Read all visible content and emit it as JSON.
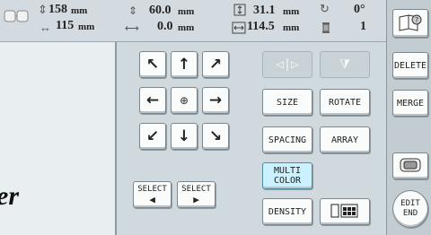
{
  "top": {
    "height_value": "158",
    "height_unit": "mm",
    "width_value": "115",
    "width_unit": "mm",
    "move_v_value": "60.0",
    "move_v_unit": "mm",
    "move_h_value": "0.0",
    "move_h_unit": "mm",
    "size_h_value": "31.1",
    "size_h_unit": "mm",
    "size_w_value": "114.5",
    "size_w_unit": "mm",
    "angle_value": "0°",
    "colors_value": "1"
  },
  "buttons": {
    "size": "SIZE",
    "rotate": "ROTATE",
    "spacing": "SPACING",
    "array": "ARRAY",
    "multi_color_line1": "MULTI",
    "multi_color_line2": "COLOR",
    "density": "DENSITY",
    "select_prev": "SELECT",
    "select_next": "SELECT"
  },
  "sidebar": {
    "delete": "DELETE",
    "merge": "MERGE",
    "edit_end_line1": "EDIT",
    "edit_end_line2": "END"
  },
  "preview": {
    "text": "er"
  },
  "icons": {
    "arrows": [
      "arrow-up-left-icon",
      "arrow-up-icon",
      "arrow-up-right-icon",
      "arrow-left-icon",
      "center-icon",
      "arrow-right-icon",
      "arrow-down-left-icon",
      "arrow-down-icon",
      "arrow-down-right-icon"
    ]
  }
}
